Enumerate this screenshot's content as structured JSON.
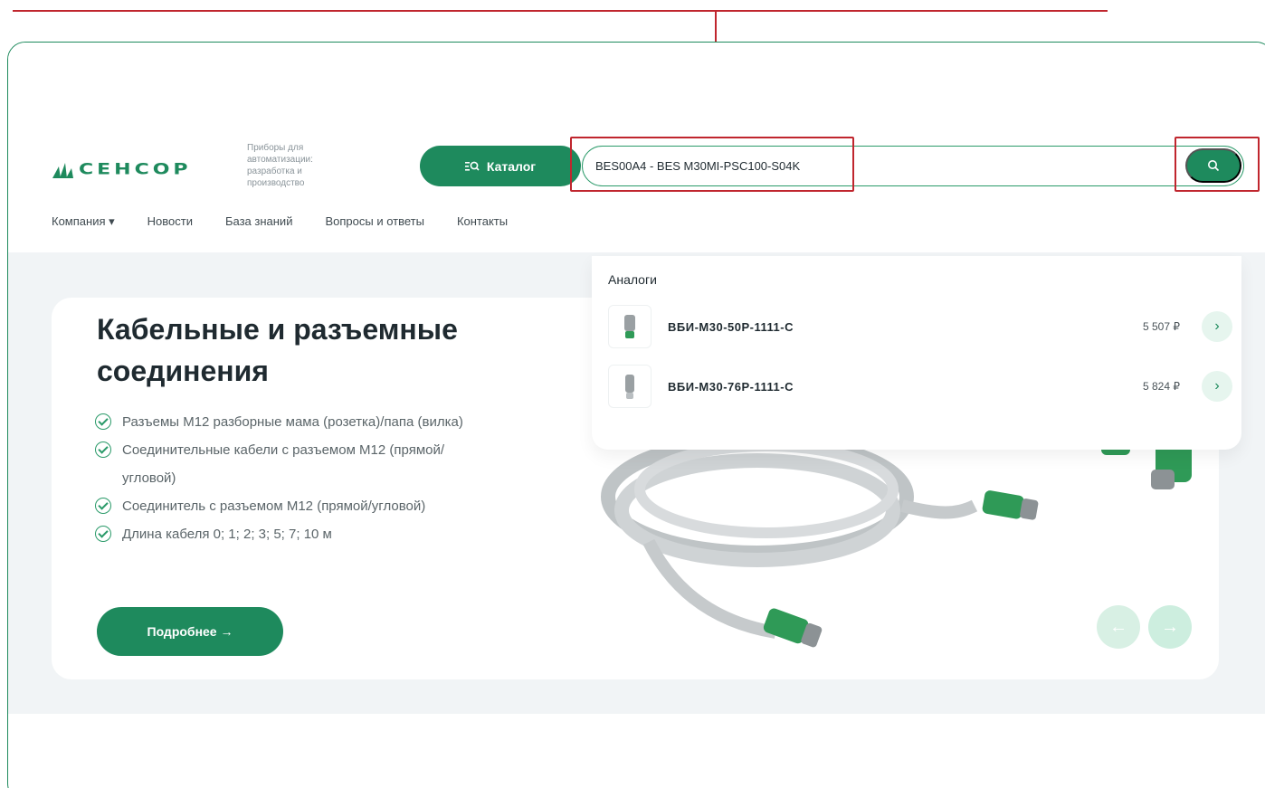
{
  "header": {
    "logo_text": "СЕНСОР",
    "tagline": "Приборы для автоматизации: разработка и производство",
    "catalog_label": "Каталог",
    "search_value": "BES00A4 - BES M30MI-PSC100-S04K"
  },
  "nav": {
    "items": [
      {
        "label": "Компания ▾"
      },
      {
        "label": "Новости"
      },
      {
        "label": "База знаний"
      },
      {
        "label": "Вопросы и ответы"
      },
      {
        "label": "Контакты"
      }
    ]
  },
  "dropdown": {
    "title": "Аналоги",
    "items": [
      {
        "name": "ВБИ-М30-50Р-1111-С",
        "price": "5 507 ₽"
      },
      {
        "name": "ВБИ-М30-76Р-1111-С",
        "price": "5 824 ₽"
      }
    ]
  },
  "hero": {
    "title": "Кабельные и разъемные соединения",
    "features": [
      {
        "text": "Разъемы М12 разборные мама (розетка)/папа (вилка)"
      },
      {
        "text": "Соединительные кабели с разъемом М12 (прямой/угловой)"
      },
      {
        "text": "Соединитель с разъемом М12 (прямой/угловой)"
      },
      {
        "text": "Длина кабеля 0; 1; 2; 3; 5; 7; 10 м"
      }
    ],
    "more_label": "Подробнее →",
    "prev_label": "←",
    "next_label": "→"
  },
  "colors": {
    "brand_green": "#1e8a5d",
    "annotation_red": "#c0262e",
    "panel_gray": "#f1f4f6"
  }
}
